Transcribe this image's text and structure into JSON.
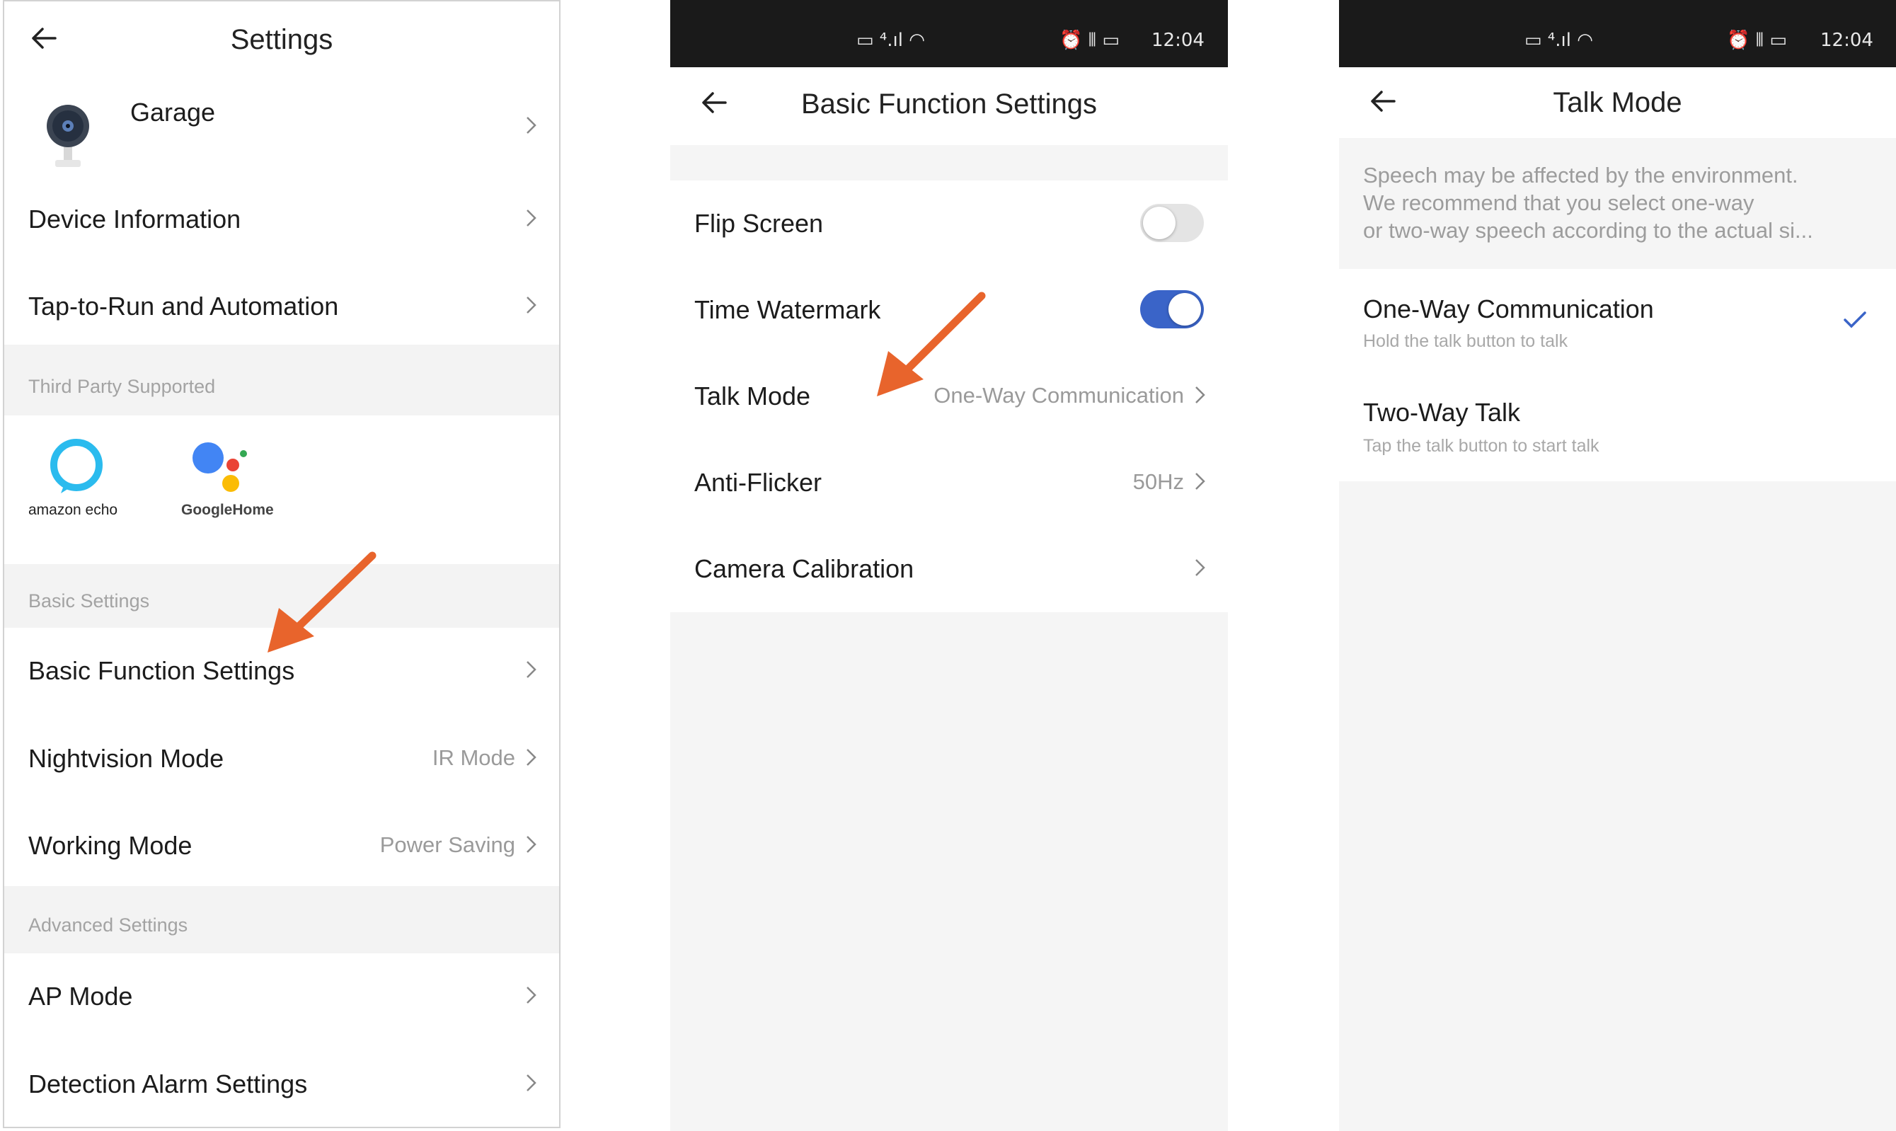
{
  "settings_screen": {
    "title": "Settings",
    "device_name": "Garage",
    "rows_top": [
      {
        "label": "Device Information"
      },
      {
        "label": "Tap-to-Run and Automation"
      }
    ],
    "third_party_header": "Third Party Supported",
    "third_party": [
      {
        "name": "amazon echo",
        "icon": "alexa-icon"
      },
      {
        "name": "GoogleHome",
        "icon": "google-assistant-icon"
      }
    ],
    "basic_header": "Basic Settings",
    "basic_rows": [
      {
        "label": "Basic Function Settings",
        "value": ""
      },
      {
        "label": "Nightvision Mode",
        "value": "IR Mode"
      },
      {
        "label": "Working Mode",
        "value": "Power Saving"
      }
    ],
    "advanced_header": "Advanced Settings",
    "advanced_rows": [
      {
        "label": "AP Mode"
      },
      {
        "label": "Detection Alarm Settings"
      }
    ]
  },
  "basic_function_screen": {
    "status_time": "12:04",
    "title": "Basic Function Settings",
    "rows": [
      {
        "label": "Flip Screen",
        "toggle": false
      },
      {
        "label": "Time Watermark",
        "toggle": true
      },
      {
        "label": "Talk Mode",
        "value": "One-Way Communication"
      },
      {
        "label": "Anti-Flicker",
        "value": "50Hz"
      },
      {
        "label": "Camera Calibration",
        "value": ""
      }
    ]
  },
  "talk_mode_screen": {
    "status_time": "12:04",
    "title": "Talk Mode",
    "notice": [
      "Speech may be affected by the environment.",
      "We recommend that you select one-way",
      "or two-way speech according to the actual si..."
    ],
    "options": [
      {
        "label": "One-Way Communication",
        "sub": "Hold the talk button to talk",
        "selected": true
      },
      {
        "label": "Two-Way Talk",
        "sub": "Tap the talk button to start talk",
        "selected": false
      }
    ]
  },
  "colors": {
    "accent": "#3a64c8",
    "arrow": "#e8642c",
    "statusbar": "#1a1a1a"
  }
}
